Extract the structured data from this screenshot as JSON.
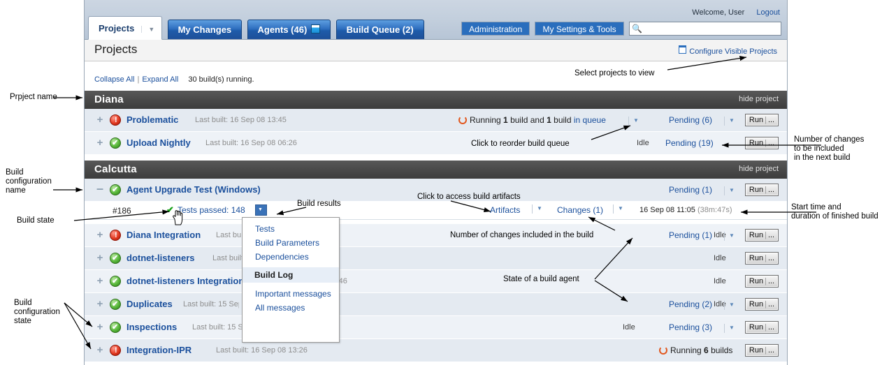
{
  "header": {
    "welcome_text": "Welcome, User",
    "logout_label": "Logout",
    "tabs": [
      {
        "label": "Projects",
        "active": true,
        "caret": "▼"
      },
      {
        "label": "My Changes",
        "active": false
      },
      {
        "label": "Agents (46)",
        "active": false,
        "icon": "agent-icon"
      },
      {
        "label": "Build Queue (2)",
        "active": false
      }
    ],
    "right_tabs": [
      {
        "label": "Administration"
      },
      {
        "label": "My Settings & Tools"
      }
    ],
    "search": {
      "value": "",
      "placeholder": "",
      "icon": "search-icon"
    }
  },
  "page": {
    "title": "Projects",
    "configure_visible_label": "Configure Visible Projects",
    "collapse_all_label": "Collapse All",
    "separator": "|",
    "expand_all_label": "Expand All",
    "running_summary": "30 build(s) running."
  },
  "projects": [
    {
      "name": "Diana",
      "hide_label": "hide project",
      "configs": [
        {
          "name": "Problematic",
          "state": "err",
          "last_built": "Last built: 16 Sep 08 13:45",
          "status_prefix": "Running ",
          "status_count1": "1",
          "status_mid": " build and ",
          "status_count2": "1",
          "status_suffix": " build ",
          "status_link": "in queue",
          "has_status_caret": true,
          "idle": "",
          "pending": "Pending (6)",
          "run_label": "Run",
          "run_sep": "|",
          "run_dots": "..."
        },
        {
          "name": "Upload Nightly",
          "state": "ok",
          "last_built": "Last built: 16 Sep 08 06:26",
          "idle": "Idle",
          "pending": "Pending (19)",
          "run_label": "Run",
          "run_sep": "|",
          "run_dots": "..."
        }
      ]
    },
    {
      "name": "Calcutta",
      "hide_label": "hide project",
      "configs": [
        {
          "name": "Agent Upgrade Test (Windows)",
          "state": "ok",
          "expander": "minus",
          "last_built": "",
          "idle": "",
          "pending": "Pending (1)",
          "run_label": "Run",
          "run_sep": "|",
          "run_dots": "..."
        },
        {
          "name": "Diana Integration",
          "state": "err",
          "last_built": "Last built: 16 Sep 08 13:45",
          "idle": "Idle",
          "pending": "Pending (1)",
          "run_label": "Run",
          "run_sep": "|",
          "run_dots": "..."
        },
        {
          "name": "dotnet-listeners",
          "state": "ok",
          "last_built": "Last built: 15 Sep 08 16:21",
          "idle": "Idle",
          "pending": "",
          "run_label": "Run",
          "run_sep": "|",
          "run_dots": "..."
        },
        {
          "name": "dotnet-listeners Integration",
          "state": "ok",
          "last_built": "Last built: 15 Sep 08 16:46",
          "idle": "Idle",
          "pending": "",
          "run_label": "Run",
          "run_sep": "|",
          "run_dots": "..."
        },
        {
          "name": "Duplicates",
          "state": "ok",
          "last_built": "Last built: 15 Sep 08 18:02",
          "idle": "Idle",
          "pending": "Pending (2)",
          "run_label": "Run",
          "run_sep": "|",
          "run_dots": "..."
        },
        {
          "name": "Inspections",
          "state": "ok",
          "last_built": "Last built: 15 Sep 08 19:11",
          "idle": "Idle",
          "pending": "Pending (3)",
          "run_label": "Run",
          "run_sep": "|",
          "run_dots": "..."
        },
        {
          "name": "Integration-IPR",
          "state": "err",
          "last_built": "Last built: 16 Sep 08 13:26",
          "running_text_prefix": "Running ",
          "running_count": "6",
          "running_text_suffix": " builds",
          "idle": "",
          "pending": "",
          "run_label": "Run",
          "run_sep": "|",
          "run_dots": "..."
        }
      ]
    }
  ],
  "build_detail": {
    "number": "#186",
    "tick": "✔",
    "tests_result": "Tests passed: 148",
    "results_button_icon": "chevron-down-icon",
    "artifacts_label": "Artifacts",
    "changes_label": "Changes (1)",
    "timestamp": "16 Sep 08 11:05",
    "duration": "(38m:47s)"
  },
  "popup_menu": {
    "items_top": [
      "Tests",
      "Build Parameters",
      "Dependencies"
    ],
    "section_title": "Build Log",
    "items_bottom": [
      "Important messages",
      "All messages"
    ]
  },
  "annotations": [
    {
      "id": "project-name",
      "text": "Prpject name"
    },
    {
      "id": "build-configuration-name",
      "text": "Build\nconfiguration\nname"
    },
    {
      "id": "build-configuration-state",
      "text": "Build\nconfiguration\nstate"
    },
    {
      "id": "build-state",
      "text": "Build state"
    },
    {
      "id": "build-results",
      "text": "Build results"
    },
    {
      "id": "select-projects-to-view",
      "text": "Select projects to view"
    },
    {
      "id": "click-to-reorder-build-queue",
      "text": "Click to reorder build queue"
    },
    {
      "id": "click-to-access-build-artifacts",
      "text": "Click to access build artifacts"
    },
    {
      "id": "number-of-changes-in-build",
      "text": "Number of changes included in the build"
    },
    {
      "id": "state-of-build-agent",
      "text": "State of a build agent"
    },
    {
      "id": "number-of-changes-next-build",
      "text": "Number of changes\nto be included\nin the next build"
    },
    {
      "id": "start-time-duration",
      "text": "Start time and\nduration of finished build"
    }
  ]
}
